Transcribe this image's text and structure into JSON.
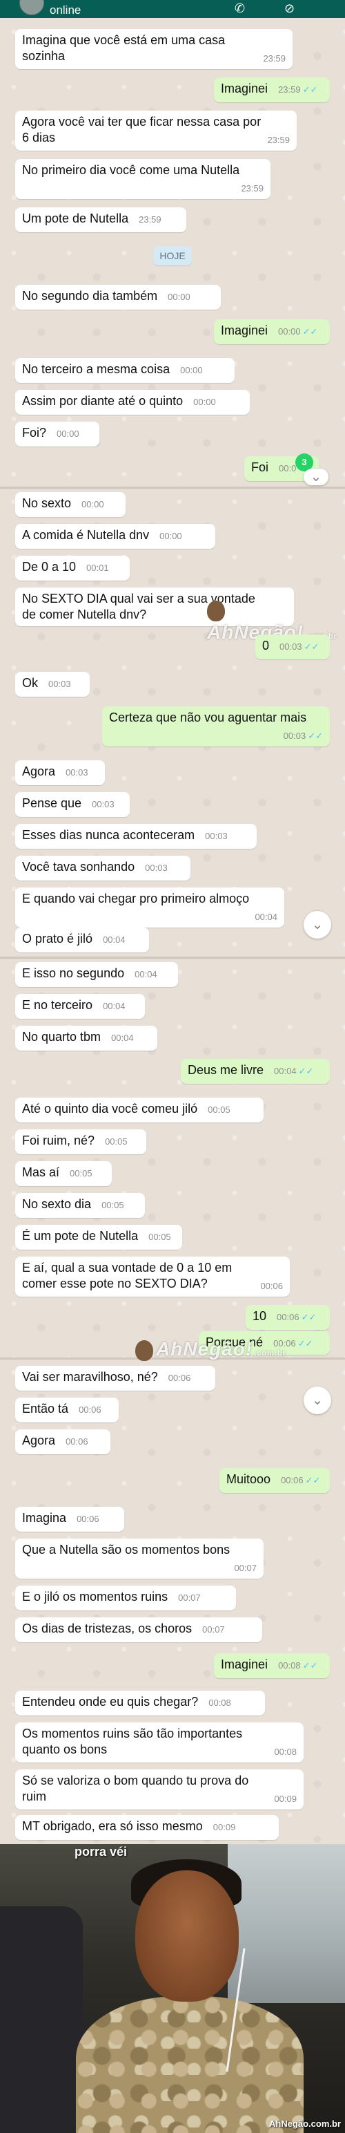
{
  "header": {
    "status": "online"
  },
  "date_chip": "HOJE",
  "watermark": {
    "brand": "AhNegão!",
    "domain": ".com.br"
  },
  "screen1": [
    {
      "dir": "in",
      "text": "Imagina que você está em uma casa\nsozinha",
      "time": "23:59"
    },
    {
      "dir": "out",
      "text": "Imaginei",
      "time": "23:59"
    },
    {
      "dir": "in",
      "text": "Agora você vai ter que ficar nessa casa por\n6 dias",
      "time": "23:59"
    },
    {
      "dir": "in",
      "text": "No primeiro dia você come uma Nutella",
      "time": "23:59"
    },
    {
      "dir": "in",
      "text": "Um pote de Nutella",
      "time": "23:59"
    },
    {
      "dir": "in",
      "text": "No segundo dia também",
      "time": "00:00"
    },
    {
      "dir": "out",
      "text": "Imaginei",
      "time": "00:00"
    },
    {
      "dir": "in",
      "text": "No terceiro a mesma coisa",
      "time": "00:00"
    },
    {
      "dir": "in",
      "text": "Assim por diante até o quinto",
      "time": "00:00"
    },
    {
      "dir": "in",
      "text": "Foi?",
      "time": "00:00"
    },
    {
      "dir": "out",
      "text": "Foi",
      "time": "00:0"
    }
  ],
  "unread_badge": "3",
  "screen2": [
    {
      "dir": "in",
      "text": "No sexto",
      "time": "00:00"
    },
    {
      "dir": "in",
      "text": "A comida é Nutella dnv",
      "time": "00:00"
    },
    {
      "dir": "in",
      "text": "De 0 a 10",
      "time": "00:01"
    },
    {
      "dir": "in",
      "text": "No SEXTO DIA qual vai ser a sua vontade\nde comer Nutella dnv?",
      "time": "00:02"
    },
    {
      "dir": "out",
      "text": "0",
      "time": "00:03"
    },
    {
      "dir": "in",
      "text": "Ok",
      "time": "00:03"
    },
    {
      "dir": "out",
      "text": "Certeza que não vou aguentar mais",
      "time": "00:03"
    },
    {
      "dir": "in",
      "text": "Agora",
      "time": "00:03"
    },
    {
      "dir": "in",
      "text": "Pense que",
      "time": "00:03"
    },
    {
      "dir": "in",
      "text": "Esses dias nunca aconteceram",
      "time": "00:03"
    },
    {
      "dir": "in",
      "text": "Você tava sonhando",
      "time": "00:03"
    },
    {
      "dir": "in",
      "text": "E quando vai chegar pro primeiro almoço",
      "time": "00:04"
    },
    {
      "dir": "in",
      "text": "O prato é jiló",
      "time": "00:04"
    }
  ],
  "screen3": [
    {
      "dir": "in",
      "text": "E isso no segundo",
      "time": "00:04"
    },
    {
      "dir": "in",
      "text": "E no terceiro",
      "time": "00:04"
    },
    {
      "dir": "in",
      "text": "No quarto tbm",
      "time": "00:04"
    },
    {
      "dir": "out",
      "text": "Deus me livre",
      "time": "00:04"
    },
    {
      "dir": "in",
      "text": "Até o quinto dia você comeu jiló",
      "time": "00:05"
    },
    {
      "dir": "in",
      "text": "Foi ruim, né?",
      "time": "00:05"
    },
    {
      "dir": "in",
      "text": "Mas aí",
      "time": "00:05"
    },
    {
      "dir": "in",
      "text": "No sexto dia",
      "time": "00:05"
    },
    {
      "dir": "in",
      "text": "É um pote de Nutella",
      "time": "00:05"
    },
    {
      "dir": "in",
      "text": "E aí, qual a sua vontade de 0 a 10 em\ncomer esse pote no SEXTO DIA?",
      "time": "00:06"
    },
    {
      "dir": "out",
      "text": "10",
      "time": "00:06"
    },
    {
      "dir": "out",
      "text": "Porque né",
      "time": "00:06"
    }
  ],
  "screen4": [
    {
      "dir": "in",
      "text": "Vai ser maravilhoso, né?",
      "time": "00:06"
    },
    {
      "dir": "in",
      "text": "Então tá",
      "time": "00:06"
    },
    {
      "dir": "in",
      "text": "Agora",
      "time": "00:06"
    },
    {
      "dir": "out",
      "text": "Muitooo",
      "time": "00:06"
    },
    {
      "dir": "in",
      "text": "Imagina",
      "time": "00:06"
    },
    {
      "dir": "in",
      "text": "Que a Nutella são os momentos bons",
      "time": "00:07"
    },
    {
      "dir": "in",
      "text": "E o jiló os momentos ruins",
      "time": "00:07"
    },
    {
      "dir": "in",
      "text": "Os dias de tristezas, os choros",
      "time": "00:07"
    },
    {
      "dir": "out",
      "text": "Imaginei",
      "time": "00:08"
    },
    {
      "dir": "in",
      "text": "Entendeu onde eu quis chegar?",
      "time": "00:08"
    },
    {
      "dir": "in",
      "text": "Os momentos ruins são tão importantes\nquanto os bons",
      "time": "00:08"
    },
    {
      "dir": "in",
      "text": "Só se valoriza o bom quando tu prova do\nruim",
      "time": "00:09"
    },
    {
      "dir": "in",
      "text": "MT obrigado, era só isso mesmo",
      "time": "00:09"
    }
  ],
  "meme": {
    "caption": "porra véi",
    "credit": "AhNegão.com.br"
  }
}
